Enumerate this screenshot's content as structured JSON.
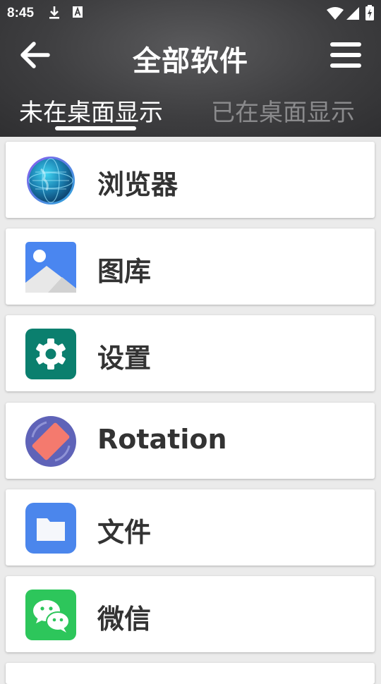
{
  "status_bar": {
    "time": "8:45",
    "icons": [
      "download-icon",
      "a-notification-icon",
      "wifi-icon",
      "signal-icon",
      "battery-charging-icon"
    ]
  },
  "header": {
    "title": "全部软件",
    "back_icon": "arrow-left-icon",
    "menu_icon": "hamburger-menu-icon",
    "tabs": [
      {
        "label": "未在桌面显示",
        "active": true
      },
      {
        "label": "已在桌面显示",
        "active": false
      }
    ]
  },
  "apps": [
    {
      "name": "浏览器",
      "icon": "globe-browser-icon"
    },
    {
      "name": "图库",
      "icon": "gallery-image-icon"
    },
    {
      "name": "设置",
      "icon": "gear-settings-icon"
    },
    {
      "name": "Rotation",
      "icon": "rotation-icon"
    },
    {
      "name": "文件",
      "icon": "folder-files-icon"
    },
    {
      "name": "微信",
      "icon": "wechat-icon"
    }
  ],
  "colors": {
    "header_bg": "#3e3e40",
    "list_bg": "#ebebeb",
    "tab_active": "#ffffff",
    "tab_inactive": "#8a8a8c",
    "app_text": "#333333",
    "settings_green": "#0b7f6e",
    "gallery_blue": "#4a86f0",
    "rotation_purple": "#5f63b8",
    "rotation_salmon": "#f47a6e",
    "files_blue": "#4b86ec",
    "wechat_green": "#2dc65b"
  }
}
